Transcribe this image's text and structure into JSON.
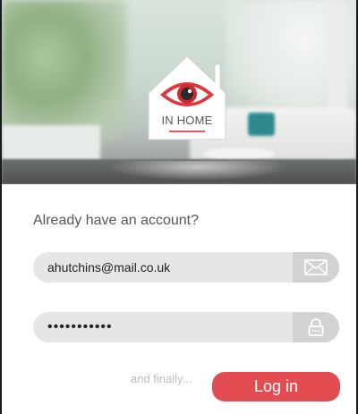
{
  "brand": {
    "logo_text": "IN HOME",
    "accent_color": "#e34d52",
    "eye_icon": "eye-icon"
  },
  "login": {
    "heading": "Already have an account?",
    "email": {
      "value": "ahutchins@mail.co.uk",
      "icon": "envelope-icon"
    },
    "password": {
      "value": "•••••••••••",
      "icon": "padlock-icon"
    },
    "finally_text": "and finally...",
    "submit_label": "Log in"
  }
}
